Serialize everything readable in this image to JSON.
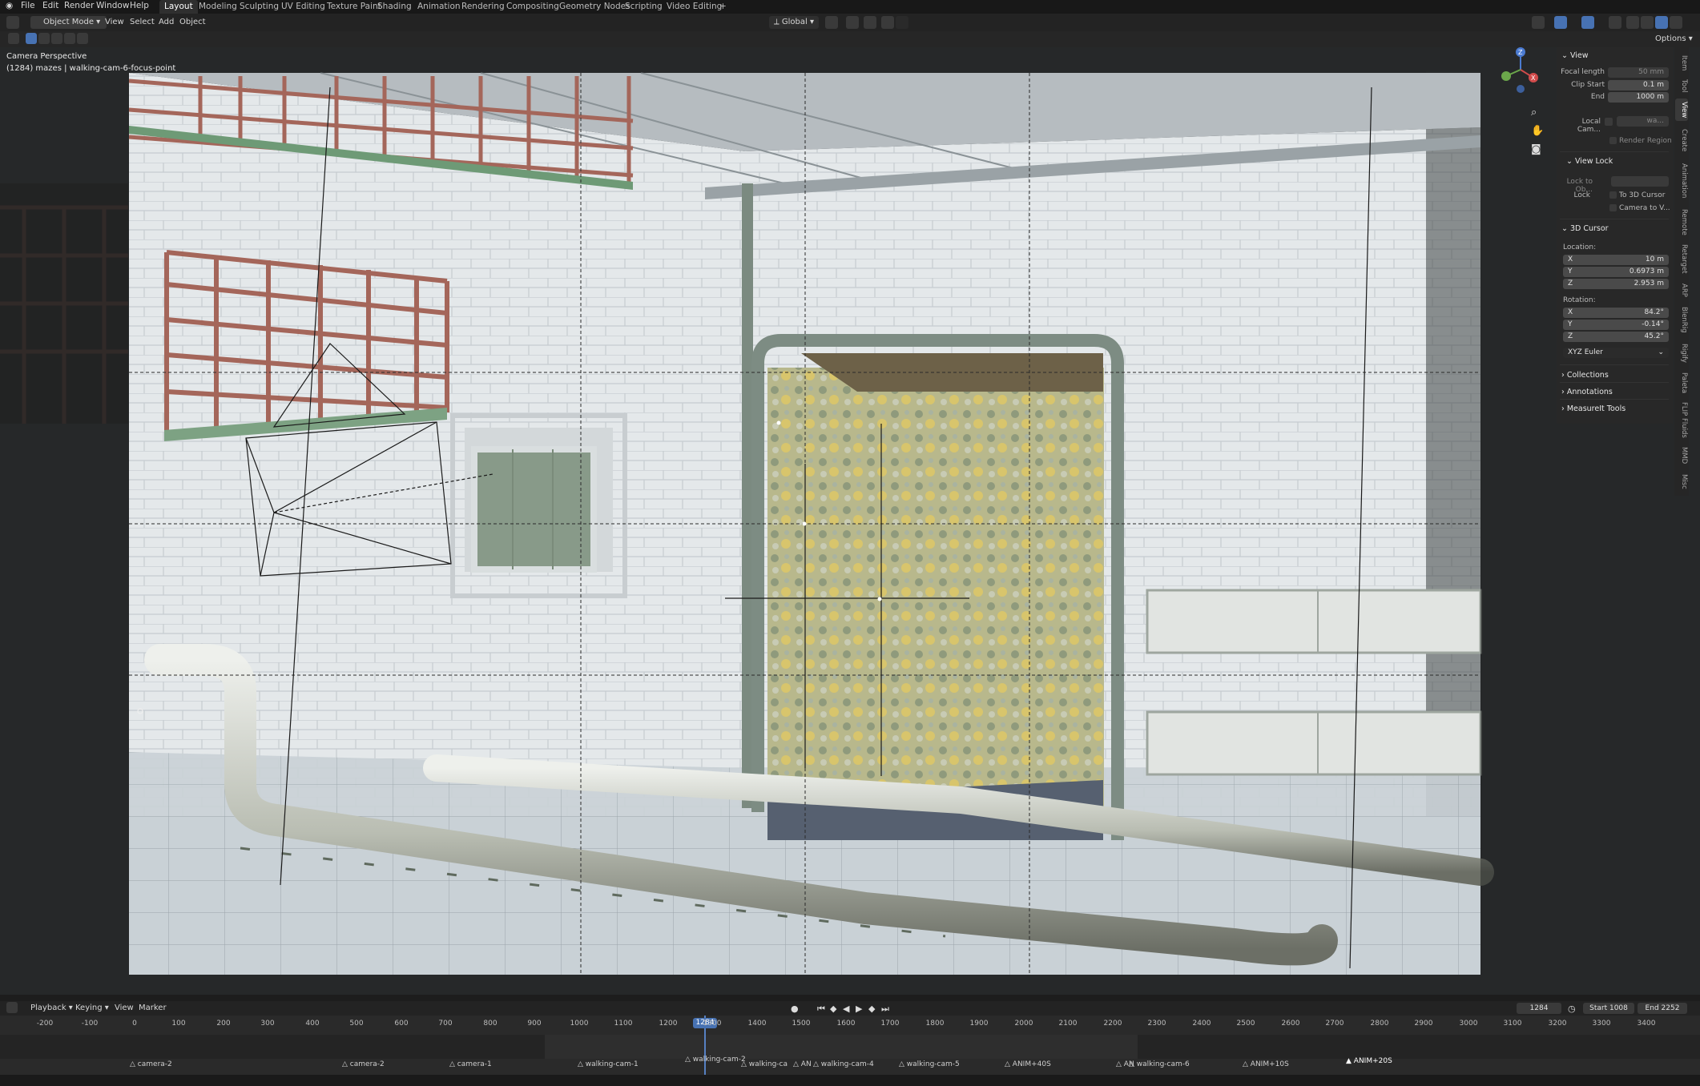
{
  "menu": [
    "File",
    "Edit",
    "Render",
    "Window",
    "Help"
  ],
  "workspaces": [
    "Layout",
    "Modeling",
    "Sculpting",
    "UV Editing",
    "Texture Paint",
    "Shading",
    "Animation",
    "Rendering",
    "Compositing",
    "Geometry Nodes",
    "Scripting",
    "Video Editing"
  ],
  "add_tab": "+",
  "header": {
    "mode": "Object Mode",
    "view": "View",
    "select": "Select",
    "add": "Add",
    "object": "Object",
    "orientation": "Global",
    "options": "Options"
  },
  "overlay": {
    "title": "Camera Perspective",
    "subtitle": "(1284) mazes | walking-cam-6-focus-point"
  },
  "npanel": {
    "view_section": "View",
    "focal_length_label": "Focal length",
    "focal_length": "50 mm",
    "clip_start_label": "Clip Start",
    "clip_start": "0.1 m",
    "end_label": "End",
    "end": "1000 m",
    "local_camera_label": "Local Cam...",
    "local_camera_value": "wa...",
    "render_region": "Render Region",
    "view_lock_section": "View Lock",
    "lock_to_obj_label": "Lock to Ob...",
    "lock_label": "Lock",
    "to_3d_cursor": "To 3D Cursor",
    "camera_to_view": "Camera to V...",
    "cursor_section": "3D Cursor",
    "location_label": "Location:",
    "loc_x": "10 m",
    "loc_y": "0.6973 m",
    "loc_z": "2.953 m",
    "rotation_label": "Rotation:",
    "rot_x": "84.2°",
    "rot_y": "-0.14°",
    "rot_z": "45.2°",
    "rotation_mode": "XYZ Euler",
    "collections": "Collections",
    "annotations": "Annotations",
    "measureit": "MeasureIt Tools",
    "axis_labels": {
      "x": "X",
      "y": "Y",
      "z": "Z"
    }
  },
  "vtabs": [
    "Item",
    "Tool",
    "View",
    "Create",
    "Animation",
    "Remote",
    "Retarget",
    "ARP",
    "BlenRig",
    "Rigify",
    "Paleta",
    "FLIP Fluids",
    "MMD",
    "Misc"
  ],
  "timeline": {
    "playback": "Playback",
    "keying": "Keying",
    "view": "View",
    "marker": "Marker",
    "current_frame": "1284",
    "start_label": "Start",
    "start": "1008",
    "end_label": "End",
    "end": "2252",
    "ticks": [
      "-200",
      "-100",
      "0",
      "100",
      "200",
      "300",
      "400",
      "500",
      "600",
      "700",
      "800",
      "900",
      "1000",
      "1100",
      "1200",
      "1300",
      "1400",
      "1500",
      "1600",
      "1700",
      "1800",
      "1900",
      "2000",
      "2100",
      "2200",
      "2300",
      "2400",
      "2500",
      "2600",
      "2700",
      "2800",
      "2900",
      "3000",
      "3100",
      "3200",
      "3300",
      "3400"
    ],
    "markers": [
      "camera-2",
      "camera-2",
      "camera-1",
      "walking-cam-1",
      "walking-cam-2",
      "walking-ca",
      "AN",
      "walking-cam-4",
      "walking-cam-5",
      "ANIM+40S",
      "AN",
      "walking-cam-6",
      "ANIM+10S",
      "ANIM+20S"
    ]
  },
  "colors": {
    "accent": "#4772b3",
    "playhead": "#5680c2",
    "wall": "#e6eaec",
    "frame_pipe": "#7d8c83",
    "railing": "#a4665a"
  }
}
